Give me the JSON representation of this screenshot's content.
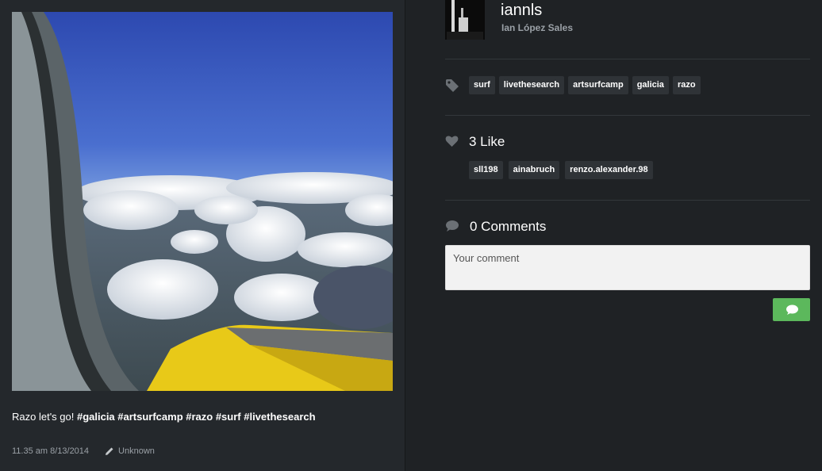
{
  "post": {
    "caption_text": "Razo let's go! ",
    "caption_hashtags": "#galicia #artsurfcamp #razo #surf #livethesearch",
    "timestamp": "11.35 am 8/13/2014",
    "filter": "Unknown"
  },
  "user": {
    "username": "iannls",
    "full_name": "Ian López Sales"
  },
  "tags": [
    "surf",
    "livethesearch",
    "artsurfcamp",
    "galicia",
    "razo"
  ],
  "likes": {
    "label": "3 Like",
    "users": [
      "sll198",
      "ainabruch",
      "renzo.alexander.98"
    ]
  },
  "comments": {
    "label": "0 Comments",
    "placeholder": "Your comment"
  },
  "icons": {
    "tag": "tag-icon",
    "like": "heart-icon",
    "comments": "speech-bubble-icon",
    "filter": "pencil-icon",
    "send": "speech-bubble-icon"
  },
  "colors": {
    "send_button": "#5cb85c",
    "background_left": "#24282c",
    "background_right": "#1f2225",
    "chip": "#2f3337"
  }
}
